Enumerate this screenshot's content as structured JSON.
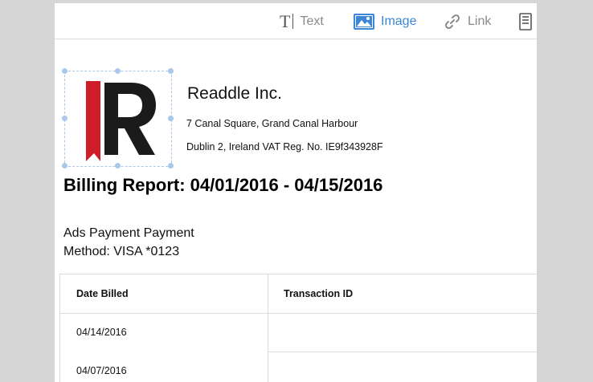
{
  "toolbar": {
    "items": [
      {
        "label": "Text",
        "icon": "text-cursor-icon"
      },
      {
        "label": "Image",
        "icon": "image-icon",
        "active": true
      },
      {
        "label": "Link",
        "icon": "link-icon"
      },
      {
        "label": "",
        "icon": "document-icon"
      }
    ],
    "accent_color": "#3b86d6"
  },
  "company": {
    "logo_letter": "R",
    "name": "Readdle Inc.",
    "address_line1": "7 Canal Square, Grand Canal Harbour",
    "address_line2": "Dublin 2, Ireland VAT Reg. No. IE9f343928F"
  },
  "report": {
    "title": "Billing Report: 04/01/2016 - 04/15/2016",
    "payment_line1": "Ads Payment Payment",
    "payment_line2": "Method: VISA *0123"
  },
  "table": {
    "headers": [
      "Date Billed",
      "Transaction ID"
    ],
    "rows": [
      [
        "04/14/2016",
        ""
      ],
      [
        "04/07/2016",
        ""
      ]
    ]
  }
}
